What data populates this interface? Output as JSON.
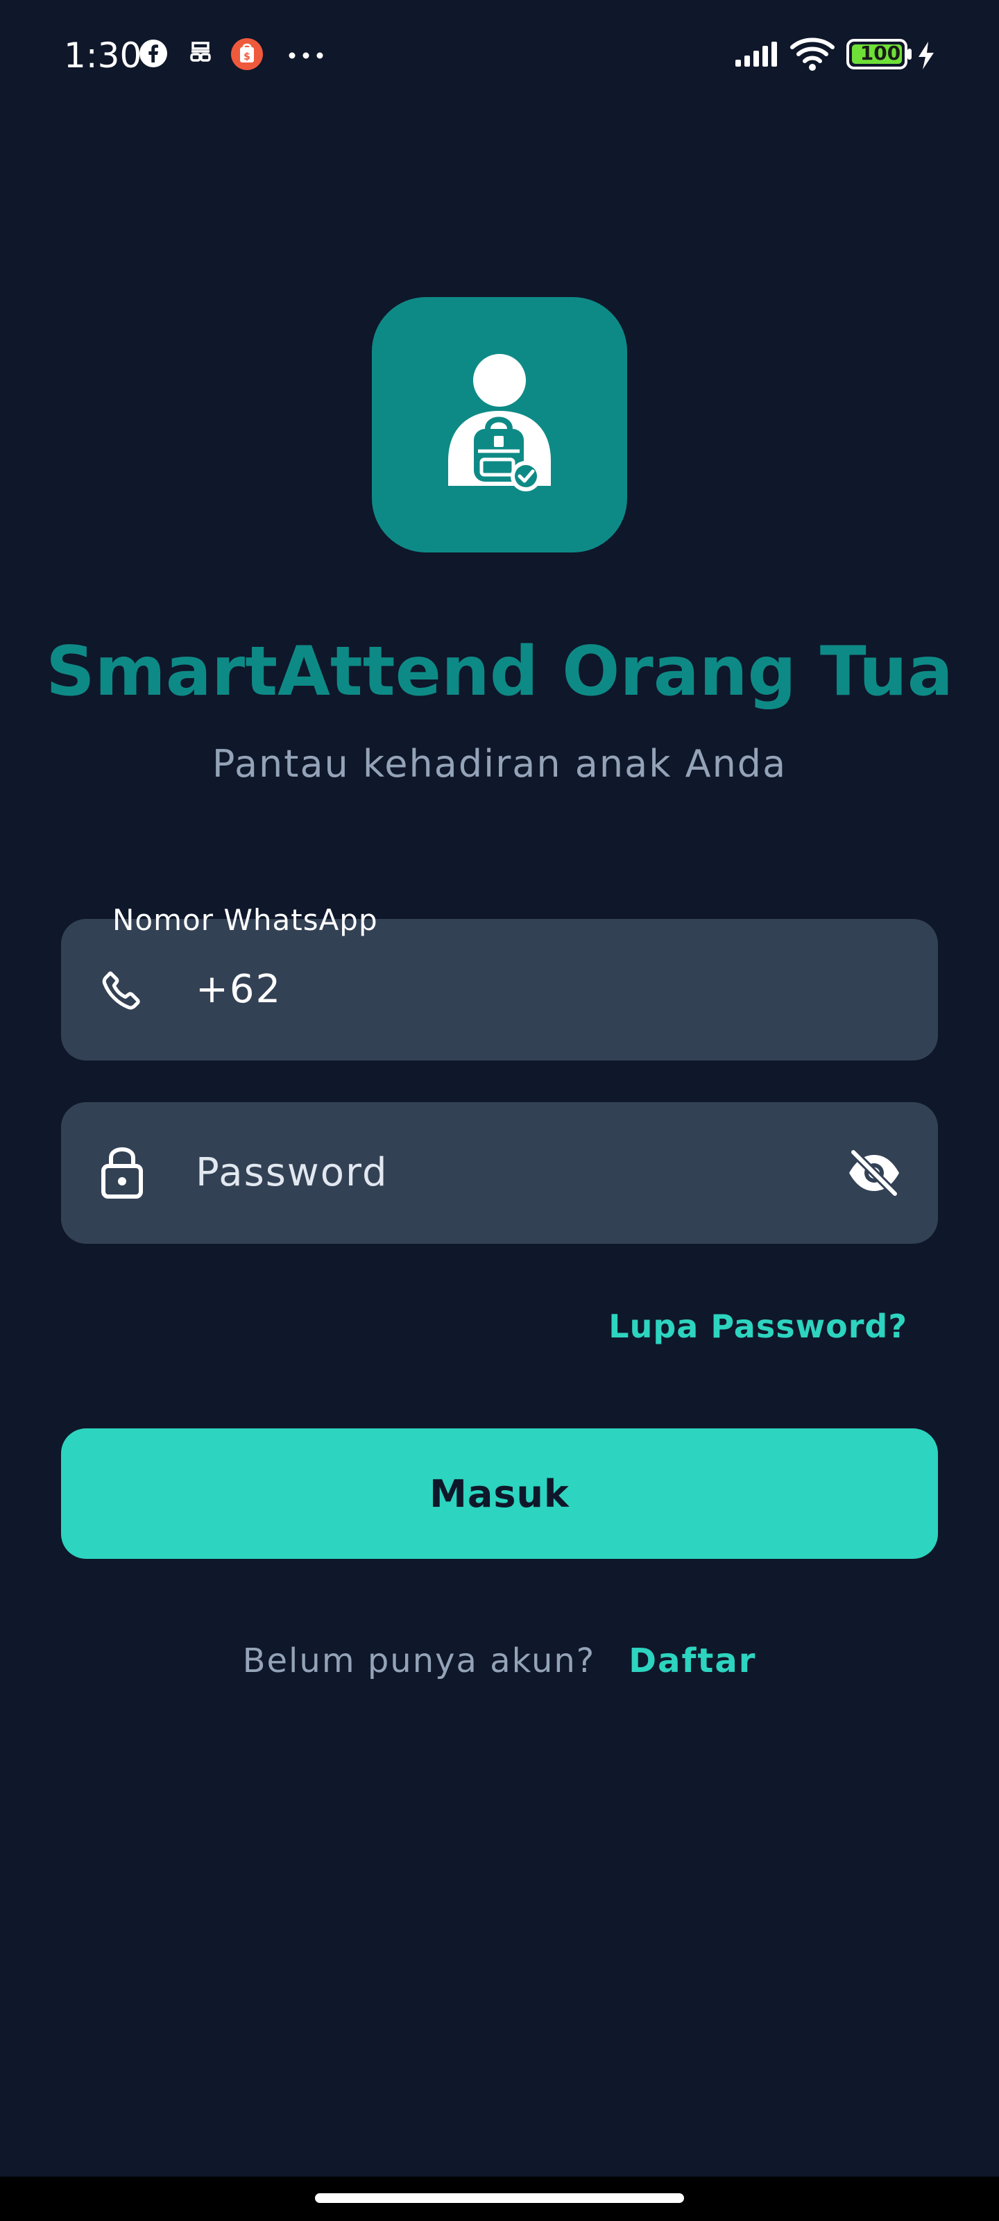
{
  "status_bar": {
    "time": "1:30",
    "battery": "100",
    "icons": [
      "facebook-icon",
      "glasses-icon",
      "shop-icon",
      "more-dots-icon",
      "signal-icon",
      "wifi-icon",
      "battery-icon",
      "charging-icon"
    ]
  },
  "app": {
    "logo_icon": "student-backpack-check-icon",
    "title": "SmartAttend Orang Tua",
    "subtitle": "Pantau kehadiran anak Anda"
  },
  "form": {
    "phone": {
      "label": "Nomor WhatsApp",
      "value": "+62",
      "icon": "phone-icon"
    },
    "password": {
      "placeholder": "Password",
      "icon": "lock-icon",
      "toggle_icon": "eye-off-icon"
    },
    "forgot_password": "Lupa Password?",
    "submit_label": "Masuk"
  },
  "register": {
    "prompt": "Belum punya akun?",
    "link": "Daftar"
  },
  "colors": {
    "background": "#0f172a",
    "field": "#334155",
    "brand": "#0e8a86",
    "accent": "#2dd4bf",
    "muted": "#94a3b8"
  }
}
